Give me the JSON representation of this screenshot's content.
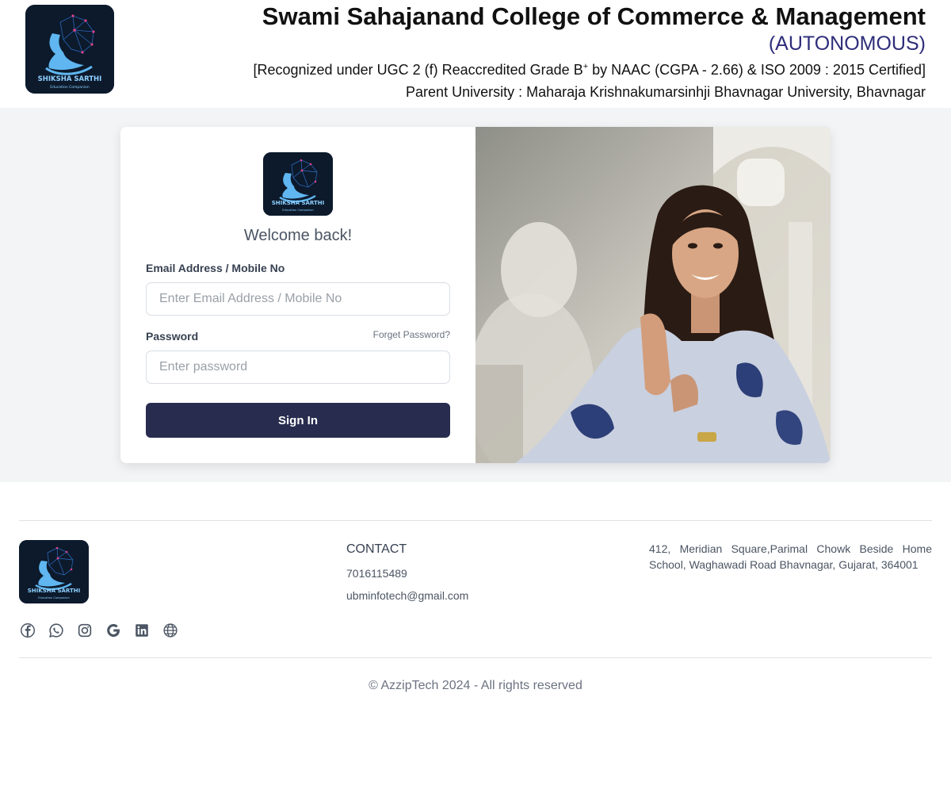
{
  "header": {
    "logo_alt": "SHIKSHA SARTHI Education Companion",
    "logo_text": "SHIKSHA SARTHI",
    "logo_tagline": "Education Companion",
    "college_name": "Swami Sahajanand College of Commerce & Management",
    "status": "(AUTONOMOUS)",
    "recognition_pre": "[Recognized under UGC 2 (f) Reaccredited Grade B",
    "recognition_sup": "+",
    "recognition_post": " by NAAC (CGPA - 2.66) & ISO 2009 : 2015 Certified]",
    "parent_university": "Parent University : Maharaja Krishnakumarsinhji Bhavnagar University, Bhavnagar"
  },
  "login": {
    "welcome": "Welcome back!",
    "email_label": "Email Address / Mobile No",
    "email_placeholder": "Enter Email Address / Mobile No",
    "email_value": "",
    "password_label": "Password",
    "password_placeholder": "Enter password",
    "password_value": "",
    "forgot_label": "Forget Password?",
    "signin_label": "Sign In"
  },
  "footer": {
    "contact_heading": "CONTACT",
    "phone": "7016115489",
    "email": "ubminfotech@gmail.com",
    "address": "412, Meridian Square,Parimal Chowk Beside Home School, Waghawadi Road Bhavnagar, Gujarat, 364001",
    "socials": [
      "facebook-icon",
      "whatsapp-icon",
      "instagram-icon",
      "google-icon",
      "linkedin-icon",
      "globe-icon"
    ],
    "copyright": "© AzzipTech 2024 - All rights reserved"
  },
  "colors": {
    "brand_navy": "#282d4f",
    "accent_indigo": "#2e2d7a",
    "band_background": "#f3f4f6",
    "logo_background": "#0c1a2c"
  }
}
